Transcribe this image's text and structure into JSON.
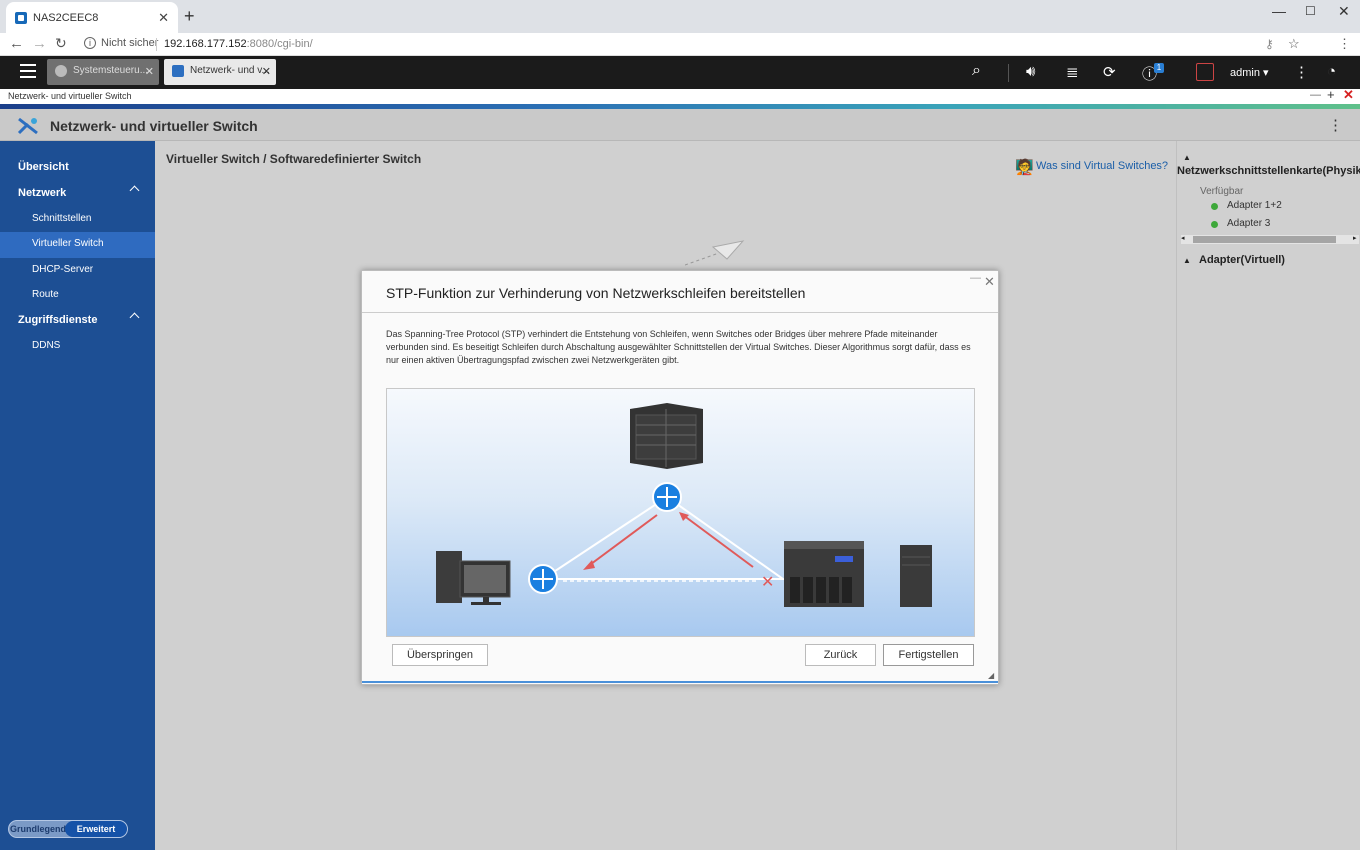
{
  "browser": {
    "tab_title": "NAS2CEEC8",
    "security": "Nicht sicher",
    "url_host": "192.168.177.152",
    "url_rest": ":8080/cgi-bin/"
  },
  "qts": {
    "tabs": [
      {
        "label": "Systemsteueru..."
      },
      {
        "label": "Netzwerk- und v..."
      }
    ],
    "user": "admin",
    "notification_count": "1"
  },
  "window": {
    "subheader": "Netzwerk- und virtueller Switch",
    "title": "Netzwerk- und virtueller Switch"
  },
  "sidebar": {
    "items": [
      {
        "label": "Übersicht"
      },
      {
        "label": "Netzwerk"
      },
      {
        "label": "Schnittstellen"
      },
      {
        "label": "Virtueller Switch"
      },
      {
        "label": "DHCP-Server"
      },
      {
        "label": "Route"
      },
      {
        "label": "Zugriffsdienste"
      },
      {
        "label": "DDNS"
      }
    ],
    "mode_basic": "Grundlegend",
    "mode_advanced": "Erweitert"
  },
  "main": {
    "breadcrumb": "Virtueller Switch / Softwaredefinierter Switch",
    "help_link": "Was sind Virtual Switches?"
  },
  "right_panel": {
    "nic_title": "Netzwerkschnittstellenkarte(Physikalisch)",
    "available_label": "Verfügbar",
    "adapters": [
      "Adapter 1+2",
      "Adapter 3"
    ],
    "virtual_title": "Adapter(Virtuell)"
  },
  "dialog": {
    "title": "STP-Funktion zur Verhinderung von Netzwerkschleifen bereitstellen",
    "description": "Das Spanning-Tree Protocol (STP) verhindert die Entstehung von Schleifen, wenn Switches oder Bridges über mehrere Pfade miteinander verbunden sind. Es beseitigt Schleifen durch Abschaltung ausgewählter Schnittstellen der Virtual Switches. Dieser Algorithmus sorgt dafür, dass es nur einen aktiven Übertragungspfad zwischen zwei Netzwerkgeräten gibt.",
    "skip_label": "Überspringen",
    "back_label": "Zurück",
    "finish_label": "Fertigstellen"
  },
  "colors": {
    "sidebar": "#1d4f94",
    "sidebar_active": "#2f6bc0",
    "accent": "#1a5ea8",
    "switch_blue": "#1a7fe0",
    "arrow_red": "#e05a5a",
    "status_green": "#3ea83a"
  }
}
